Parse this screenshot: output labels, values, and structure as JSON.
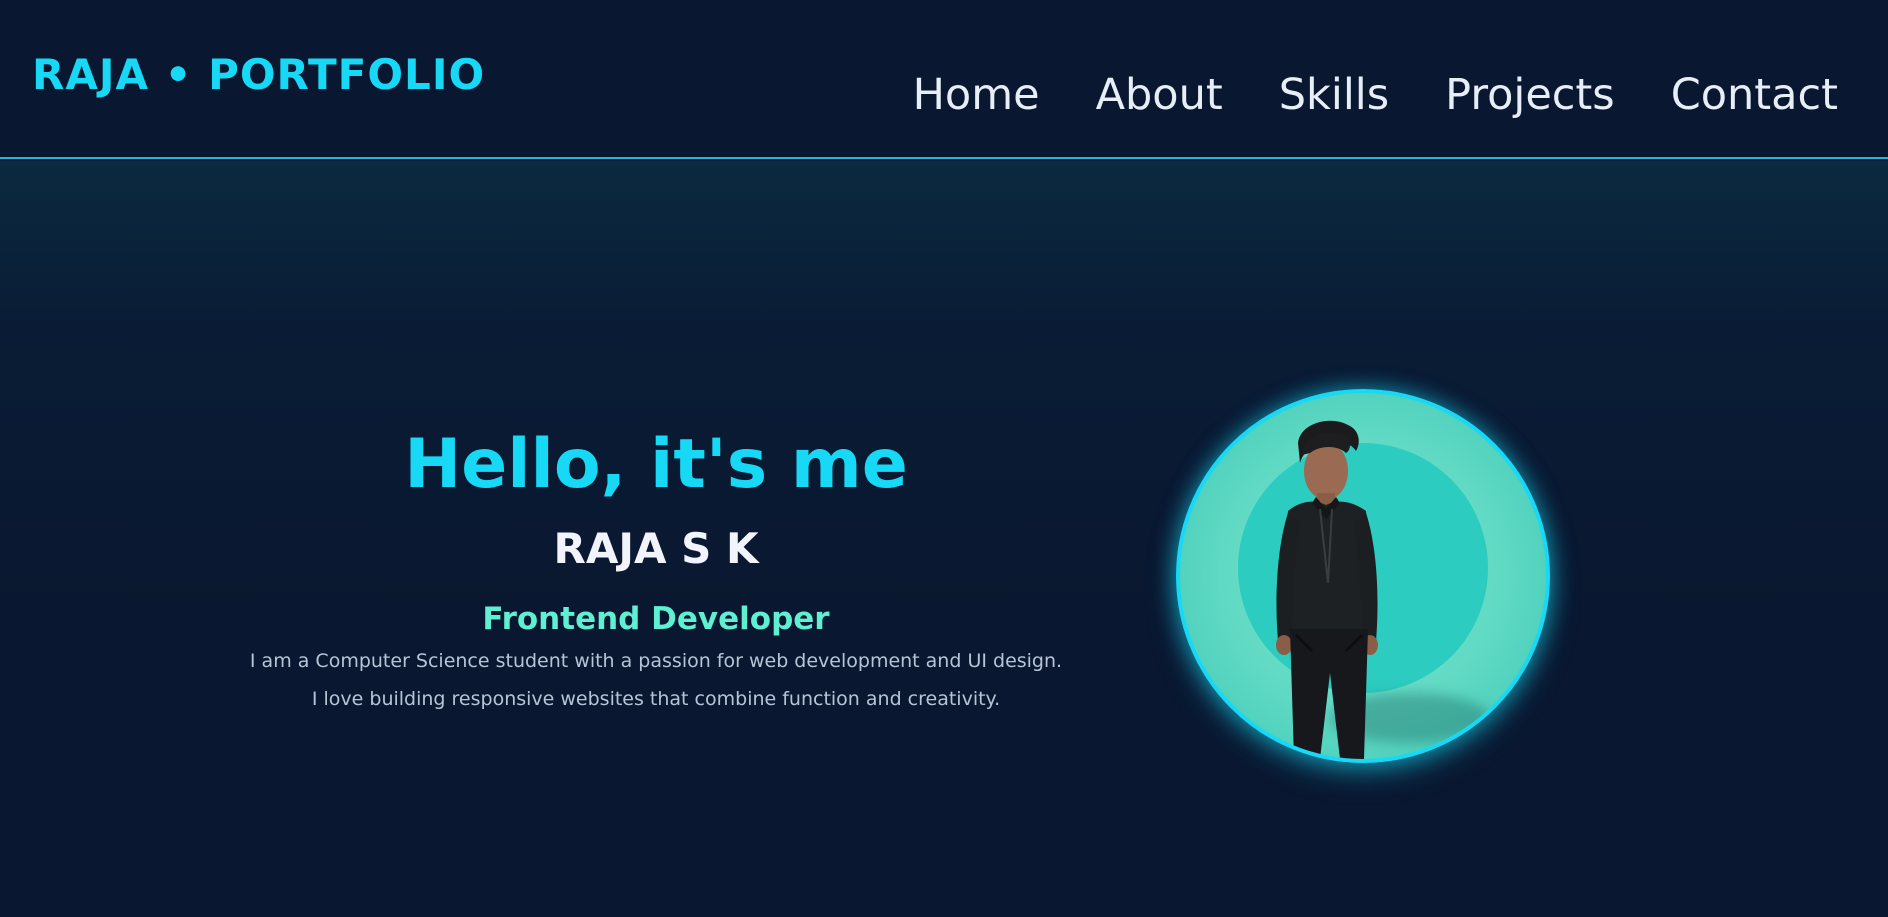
{
  "header": {
    "logo": "RAJA • PORTFOLIO",
    "nav": [
      {
        "label": "Home"
      },
      {
        "label": "About"
      },
      {
        "label": "Skills"
      },
      {
        "label": "Projects"
      },
      {
        "label": "Contact"
      }
    ]
  },
  "hero": {
    "greeting": "Hello, it's me",
    "name": "RAJA S K",
    "role": "Frontend Developer",
    "bio": "I am a Computer Science student with a passion for web development and UI design. I love building responsive websites that combine function and creativity."
  },
  "colors": {
    "background": "#0a1730",
    "accent": "#17d9f5",
    "role_accent": "#5fefd3",
    "text": "#e6eef7"
  }
}
